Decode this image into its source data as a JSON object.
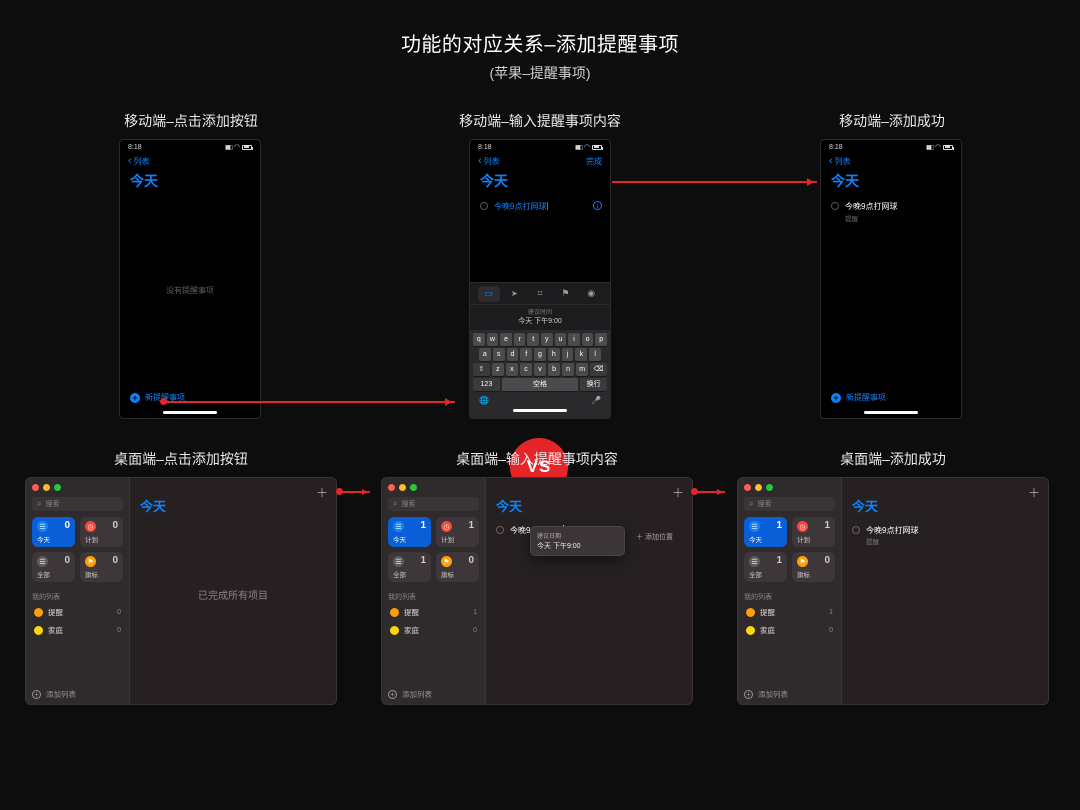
{
  "header": {
    "title": "功能的对应关系–添加提醒事项",
    "subtitle": "(苹果–提醒事项)"
  },
  "vs": "VS",
  "mobile": {
    "captions": [
      "移动端–点击添加按钮",
      "移动端–输入提醒事项内容",
      "移动端–添加成功"
    ],
    "status_time1": "8:18",
    "status_time2": "8:18",
    "status_time3": "8:18",
    "back_label": "列表",
    "heading": "今天",
    "empty": "没有提醒事项",
    "new_reminder": "新提醒事项",
    "done": "完成",
    "edit_text": "今晚9点打网球",
    "final_text": "今晚9点打网球",
    "final_sub": "提醒",
    "suggest_label": "建议时间",
    "suggest_value": "今天 下午9:00",
    "kbd": {
      "row1": [
        "q",
        "w",
        "e",
        "r",
        "t",
        "y",
        "u",
        "i",
        "o",
        "p"
      ],
      "row2": [
        "a",
        "s",
        "d",
        "f",
        "g",
        "h",
        "j",
        "k",
        "l"
      ],
      "row3": [
        "z",
        "x",
        "c",
        "v",
        "b",
        "n",
        "m"
      ],
      "num": "123",
      "space": "空格",
      "return": "换行"
    }
  },
  "desktop": {
    "captions": [
      "桌面端–点击添加按钮",
      "桌面端–输入提醒事项内容",
      "桌面端–添加成功"
    ],
    "search_placeholder": "搜索",
    "cards_a": [
      {
        "label": "今天",
        "count": "0",
        "style": "blue"
      },
      {
        "label": "计划",
        "count": "0",
        "style": "dark"
      },
      {
        "label": "全部",
        "count": "0",
        "style": "dark2"
      },
      {
        "label": "旗标",
        "count": "0",
        "style": "dark3"
      }
    ],
    "cards_b": [
      {
        "label": "今天",
        "count": "1",
        "style": "blue"
      },
      {
        "label": "计划",
        "count": "1",
        "style": "dark"
      },
      {
        "label": "全部",
        "count": "1",
        "style": "dark2"
      },
      {
        "label": "旗标",
        "count": "0",
        "style": "dark3"
      }
    ],
    "section": "我的列表",
    "lists": [
      {
        "name": "提醒",
        "color": "#ff9f0a",
        "count_a": "0",
        "count_b": "1"
      },
      {
        "name": "家庭",
        "color": "#ffd60a",
        "count_a": "0",
        "count_b": "0"
      }
    ],
    "add_list": "添加列表",
    "heading": "今天",
    "empty": "已完成所有项目",
    "edit_text": "今晚9点打网球",
    "pop_label": "建议日期",
    "pop_value": "今天 下午9:00",
    "add_suggestion": "添加位置",
    "final_text": "今晚9点打网球",
    "final_sub": "提醒"
  }
}
